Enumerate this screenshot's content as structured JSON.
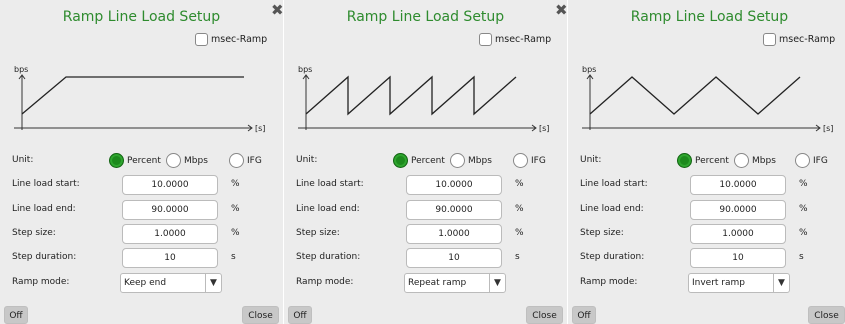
{
  "panels": [
    {
      "title": "Ramp Line Load Setup",
      "msec_label": "msec-Ramp",
      "graph_ylabel": "bps",
      "graph_xlabel": "[s]",
      "unit_label": "Unit:",
      "unit_options": [
        "Percent",
        "Mbps",
        "IFG"
      ],
      "unit_selected": "Percent",
      "start_label": "Line load start:",
      "start_value": "10.0000",
      "start_unit": "%",
      "end_label": "Line load end:",
      "end_value": "90.0000",
      "end_unit": "%",
      "step_label": "Step size:",
      "step_value": "1.0000",
      "step_unit": "%",
      "duration_label": "Step duration:",
      "duration_value": "10",
      "duration_unit": "s",
      "ramp_label": "Ramp mode:",
      "ramp_value": "Keep end",
      "off_label": "Off",
      "close_label": "Close",
      "graph_shape": "keep-end"
    },
    {
      "title": "Ramp Line Load Setup",
      "msec_label": "msec-Ramp",
      "graph_ylabel": "bps",
      "graph_xlabel": "[s]",
      "unit_label": "Unit:",
      "unit_options": [
        "Percent",
        "Mbps",
        "IFG"
      ],
      "unit_selected": "Percent",
      "start_label": "Line load start:",
      "start_value": "10.0000",
      "start_unit": "%",
      "end_label": "Line load end:",
      "end_value": "90.0000",
      "end_unit": "%",
      "step_label": "Step size:",
      "step_value": "1.0000",
      "step_unit": "%",
      "duration_label": "Step duration:",
      "duration_value": "10",
      "duration_unit": "s",
      "ramp_label": "Ramp mode:",
      "ramp_value": "Repeat ramp",
      "off_label": "Off",
      "close_label": "Close",
      "graph_shape": "repeat"
    },
    {
      "title": "Ramp Line Load Setup",
      "msec_label": "msec-Ramp",
      "graph_ylabel": "bps",
      "graph_xlabel": "[s]",
      "unit_label": "Unit:",
      "unit_options": [
        "Percent",
        "Mbps",
        "IFG"
      ],
      "unit_selected": "Percent",
      "start_label": "Line load start:",
      "start_value": "10.0000",
      "start_unit": "%",
      "end_label": "Line load end:",
      "end_value": "90.0000",
      "end_unit": "%",
      "step_label": "Step size:",
      "step_value": "1.0000",
      "step_unit": "%",
      "duration_label": "Step duration:",
      "duration_value": "10",
      "duration_unit": "s",
      "ramp_label": "Ramp mode:",
      "ramp_value": "Invert ramp",
      "off_label": "Off",
      "close_label": "Close",
      "graph_shape": "invert"
    }
  ],
  "colors": {
    "title": "#2e8b2e",
    "radio_selected": "#1d8a1d",
    "panel_bg": "#ececec"
  }
}
